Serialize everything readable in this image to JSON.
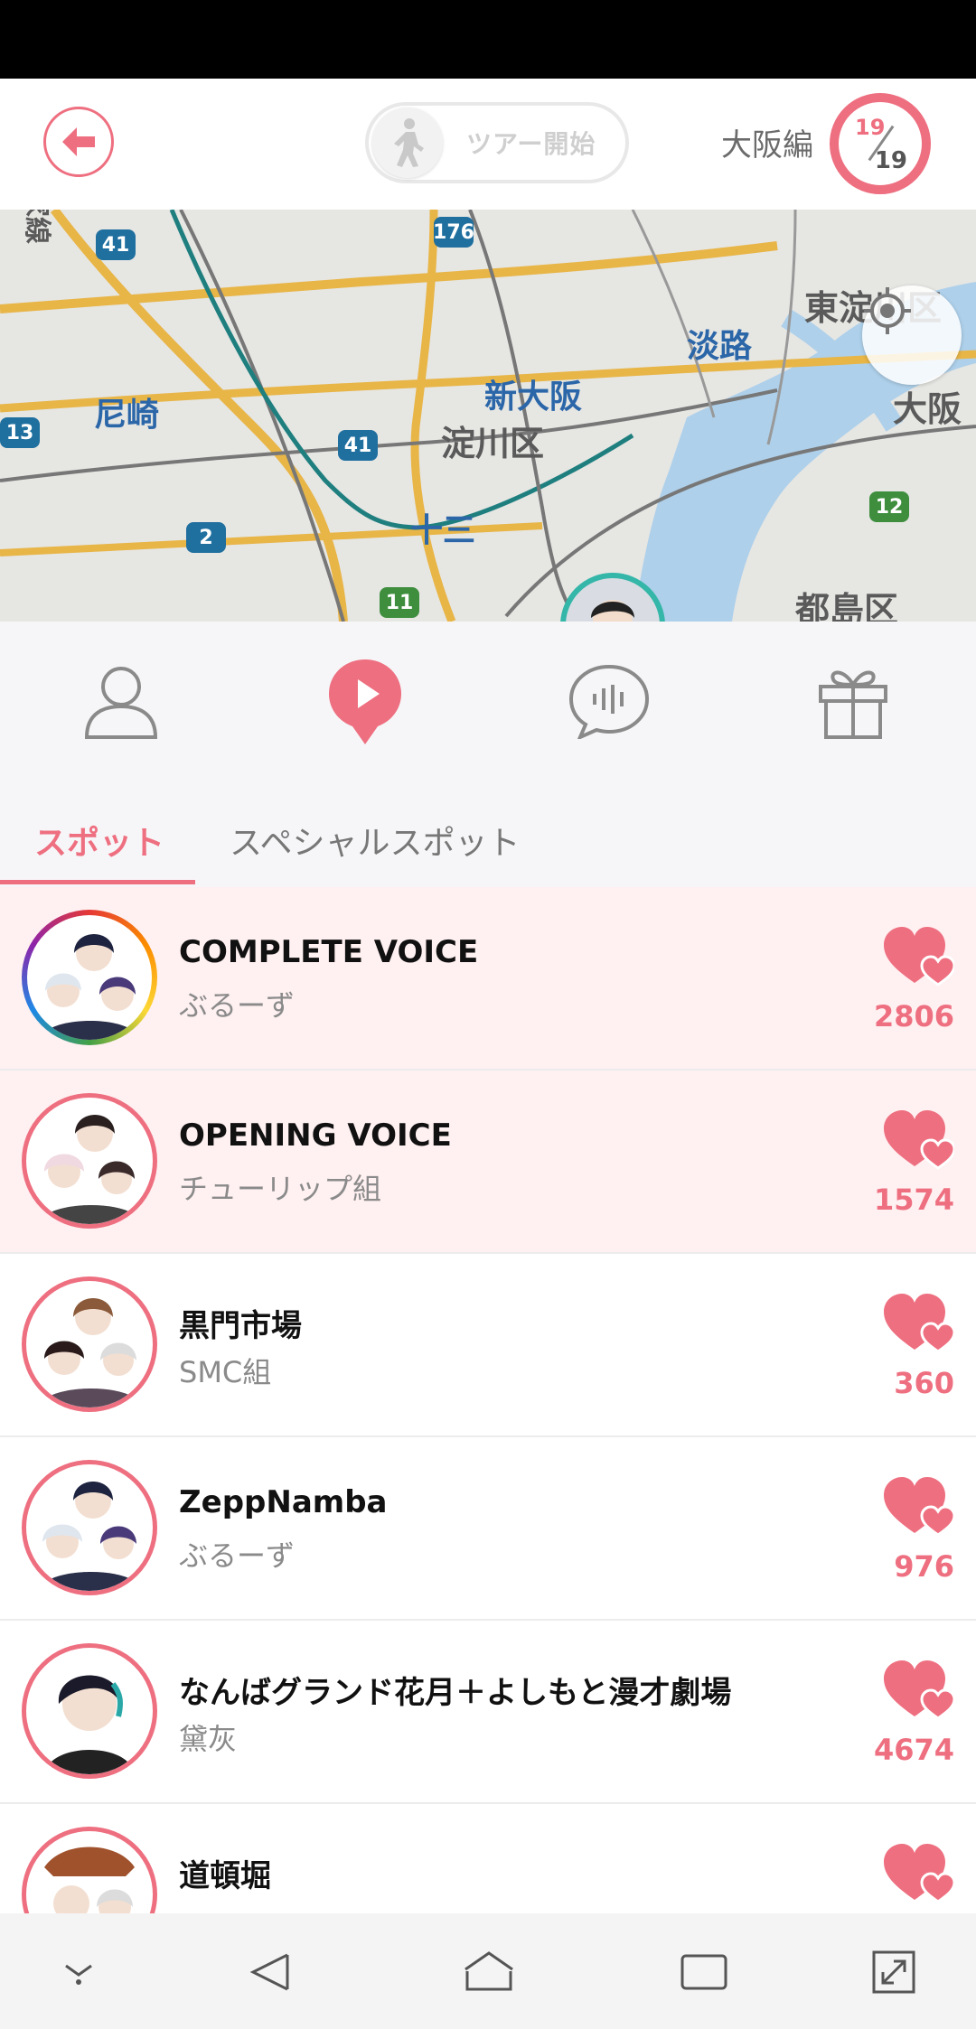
{
  "header": {
    "tour_label": "ツアー開始",
    "area_name": "大阪編",
    "progress_current": "19",
    "progress_total": "19"
  },
  "map": {
    "labels": [
      "尼崎",
      "新大阪",
      "淀川区",
      "十三",
      "淡路",
      "東淀川区",
      "大阪",
      "都島区",
      "家線"
    ],
    "route_numbers": [
      "41",
      "176",
      "13",
      "41",
      "2",
      "11",
      "12"
    ]
  },
  "tabs": {
    "spot": "スポット",
    "special": "スペシャルスポット"
  },
  "spots": [
    {
      "title": "COMPLETE VOICE",
      "subtitle": "ぶるーず",
      "likes": "2806"
    },
    {
      "title": "OPENING VOICE",
      "subtitle": "チューリップ組",
      "likes": "1574"
    },
    {
      "title": "黒門市場",
      "subtitle": "SMC組",
      "likes": "360"
    },
    {
      "title": "ZeppNamba",
      "subtitle": "ぶるーず",
      "likes": "976"
    },
    {
      "title": "なんばグランド花月＋よしもと漫才劇場",
      "subtitle": "黛灰",
      "likes": "4674"
    },
    {
      "title": "道頓堀",
      "subtitle": "",
      "likes": ""
    }
  ],
  "colors": {
    "accent": "#ee6f80",
    "highlight_row": "#fff0f1",
    "map_bg": "#e6e6e3"
  },
  "icons": [
    "back-arrow-icon",
    "walking-person-icon",
    "locate-icon",
    "person-icon",
    "play-pin-icon",
    "voice-chat-icon",
    "gift-icon",
    "heart-icon",
    "chevron-down-icon",
    "back-triangle-icon",
    "home-icon",
    "recents-icon",
    "expand-icon"
  ]
}
